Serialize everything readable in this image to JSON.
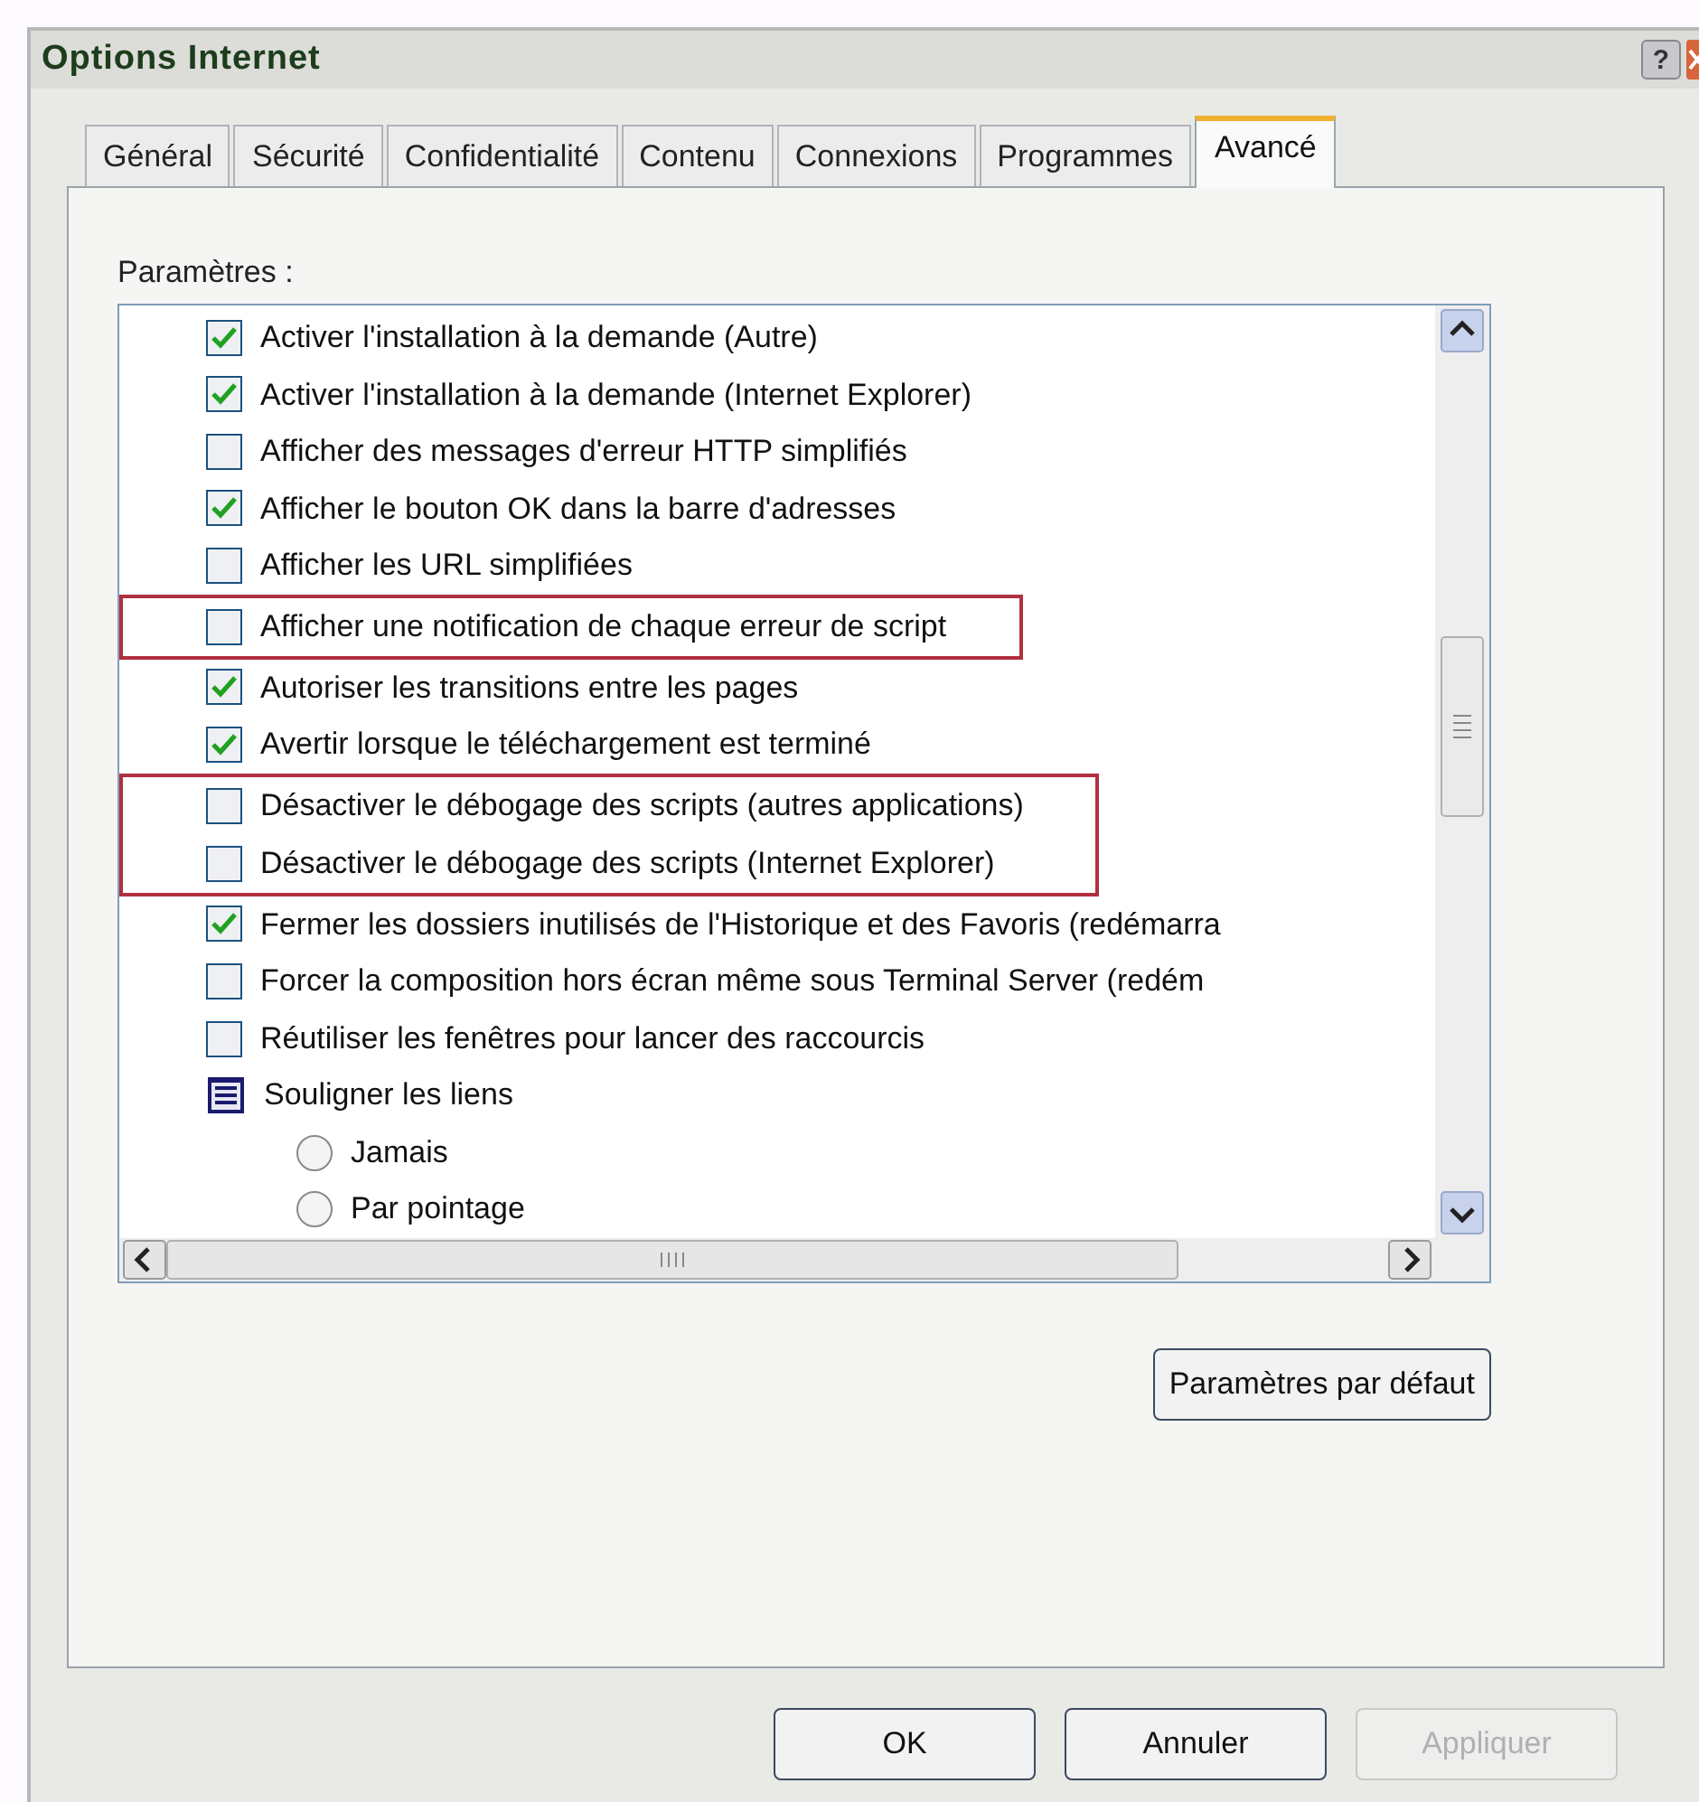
{
  "window": {
    "title": "Options Internet",
    "help_button": "?"
  },
  "tabs": [
    {
      "label": "Général",
      "selected": false
    },
    {
      "label": "Sécurité",
      "selected": false
    },
    {
      "label": "Confidentialité",
      "selected": false
    },
    {
      "label": "Contenu",
      "selected": false
    },
    {
      "label": "Connexions",
      "selected": false
    },
    {
      "label": "Programmes",
      "selected": false
    },
    {
      "label": "Avancé",
      "selected": true
    }
  ],
  "settings_label": "Paramètres :",
  "settings": [
    {
      "kind": "checkbox",
      "label": "Activer l'installation à la demande (Autre)",
      "checked": true,
      "highlighted": false
    },
    {
      "kind": "checkbox",
      "label": "Activer l'installation à la demande (Internet Explorer)",
      "checked": true,
      "highlighted": false
    },
    {
      "kind": "checkbox",
      "label": "Afficher des messages d'erreur HTTP simplifiés",
      "checked": false,
      "highlighted": false
    },
    {
      "kind": "checkbox",
      "label": "Afficher le bouton OK dans la barre d'adresses",
      "checked": true,
      "highlighted": false
    },
    {
      "kind": "checkbox",
      "label": "Afficher les URL simplifiées",
      "checked": false,
      "highlighted": false
    },
    {
      "kind": "checkbox",
      "label": "Afficher une notification de chaque erreur de script",
      "checked": false,
      "highlighted": true
    },
    {
      "kind": "checkbox",
      "label": "Autoriser les transitions entre les pages",
      "checked": true,
      "highlighted": false
    },
    {
      "kind": "checkbox",
      "label": "Avertir lorsque le téléchargement est terminé",
      "checked": true,
      "highlighted": false
    },
    {
      "kind": "checkbox",
      "label": "Désactiver le débogage des scripts (autres applications)",
      "checked": false,
      "highlighted": true
    },
    {
      "kind": "checkbox",
      "label": "Désactiver le débogage des scripts (Internet Explorer)",
      "checked": false,
      "highlighted": true
    },
    {
      "kind": "checkbox",
      "label": "Fermer les dossiers inutilisés de l'Historique et des Favoris (redémarra",
      "checked": true,
      "highlighted": false
    },
    {
      "kind": "checkbox",
      "label": "Forcer la composition hors écran même sous Terminal Server (redém",
      "checked": false,
      "highlighted": false
    },
    {
      "kind": "checkbox",
      "label": "Réutiliser les fenêtres pour lancer des raccourcis",
      "checked": false,
      "highlighted": false
    },
    {
      "kind": "group",
      "label": "Souligner les liens",
      "highlighted": false,
      "children": [
        {
          "kind": "radio",
          "label": "Jamais",
          "selected": false
        },
        {
          "kind": "radio",
          "label": "Par pointage",
          "selected": false
        }
      ]
    }
  ],
  "default_button": "Paramètres par défaut",
  "buttons": [
    {
      "label": "OK",
      "disabled": false
    },
    {
      "label": "Annuler",
      "disabled": false
    },
    {
      "label": "Appliquer",
      "disabled": true
    }
  ]
}
